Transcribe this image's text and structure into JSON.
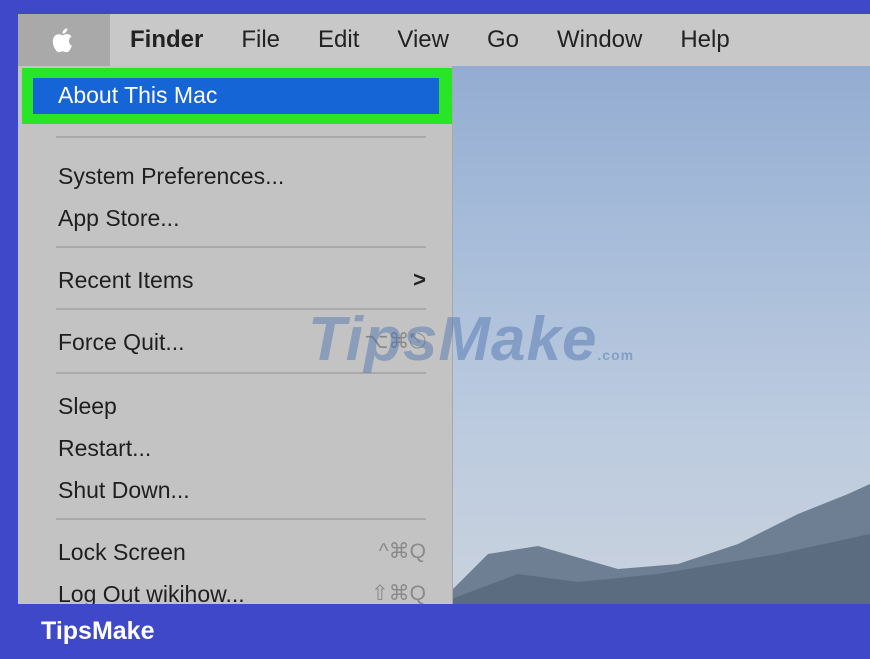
{
  "menubar": {
    "apple_icon": "apple-icon",
    "items": [
      "Finder",
      "File",
      "Edit",
      "View",
      "Go",
      "Window",
      "Help"
    ]
  },
  "apple_menu": {
    "about": "About This Mac",
    "system_prefs": "System Preferences...",
    "app_store": "App Store...",
    "recent_items": "Recent Items",
    "recent_arrow": ">",
    "force_quit": "Force Quit...",
    "force_quit_shortcut": "⌥⌘⎋",
    "sleep": "Sleep",
    "restart": "Restart...",
    "shut_down": "Shut Down...",
    "lock_screen": "Lock Screen",
    "lock_screen_shortcut": "^⌘Q",
    "log_out": "Log Out wikihow...",
    "log_out_shortcut": "⇧⌘Q"
  },
  "watermark": {
    "text": "TipsMake",
    "suffix": ".com"
  },
  "footer": {
    "brand": "TipsMake"
  },
  "colors": {
    "frame": "#3f48c8",
    "highlight_outline": "#28e528",
    "selection": "#1565d6"
  }
}
